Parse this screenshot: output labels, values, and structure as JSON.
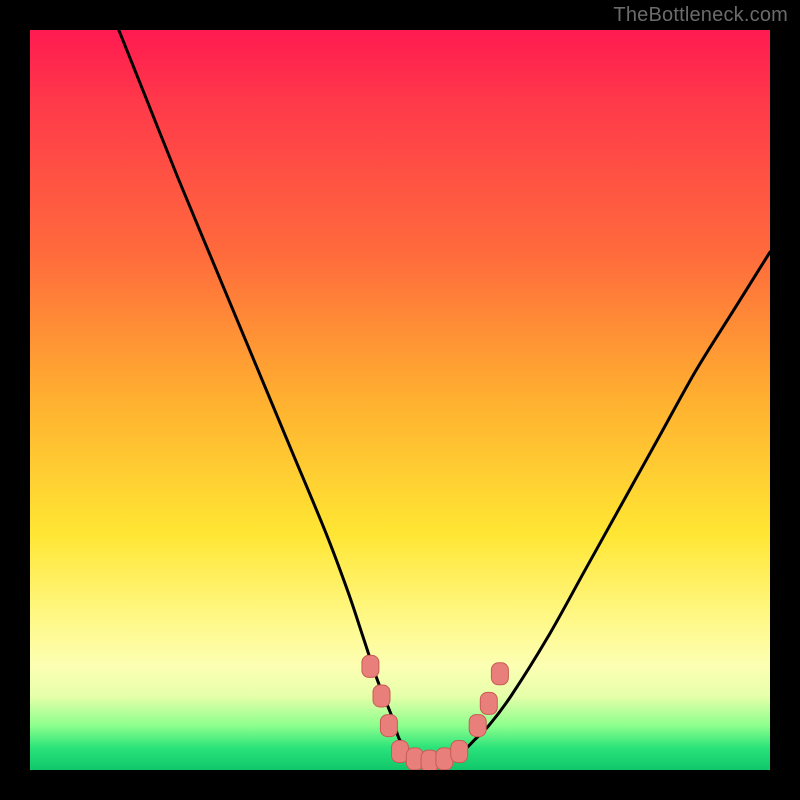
{
  "attribution": "TheBottleneck.com",
  "colors": {
    "frame": "#000000",
    "gradient_stops": [
      "#ff1a50",
      "#ff3a4a",
      "#ff6a3c",
      "#ffb030",
      "#ffe633",
      "#fff98a",
      "#fcffb3",
      "#e6ffaa",
      "#8dff8d",
      "#2be37a",
      "#0fc76a"
    ],
    "curve": "#000000",
    "marker_fill": "#e87f7b",
    "marker_stroke": "#c95b56"
  },
  "chart_data": {
    "type": "line",
    "title": "",
    "xlabel": "",
    "ylabel": "",
    "xlim": [
      0,
      100
    ],
    "ylim": [
      0,
      100
    ],
    "grid": false,
    "legend": false,
    "series": [
      {
        "name": "bottleneck-curve",
        "x": [
          12,
          16,
          20,
          25,
          30,
          35,
          40,
          43,
          45,
          47,
          49,
          50,
          52,
          54,
          56,
          58,
          60,
          62,
          65,
          70,
          75,
          80,
          85,
          90,
          95,
          100
        ],
        "y": [
          100,
          90,
          80,
          68,
          56,
          44,
          32,
          24,
          18,
          12,
          7,
          4,
          2,
          1,
          1,
          2,
          4,
          6,
          10,
          18,
          27,
          36,
          45,
          54,
          62,
          70
        ]
      }
    ],
    "markers": [
      {
        "x": 46.0,
        "y": 14
      },
      {
        "x": 47.5,
        "y": 10
      },
      {
        "x": 48.5,
        "y": 6
      },
      {
        "x": 50.0,
        "y": 2.5
      },
      {
        "x": 52.0,
        "y": 1.5
      },
      {
        "x": 54.0,
        "y": 1.2
      },
      {
        "x": 56.0,
        "y": 1.5
      },
      {
        "x": 58.0,
        "y": 2.5
      },
      {
        "x": 60.5,
        "y": 6
      },
      {
        "x": 62.0,
        "y": 9
      },
      {
        "x": 63.5,
        "y": 13
      }
    ]
  }
}
